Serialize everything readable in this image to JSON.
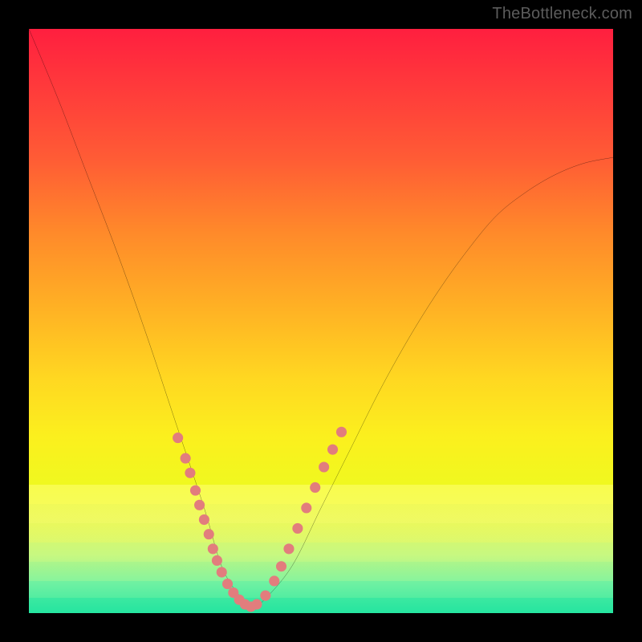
{
  "watermark": "TheBottleneck.com",
  "colors": {
    "curve": "#000000",
    "dots": "#e27d7d",
    "background_frame": "#000000"
  },
  "chart_data": {
    "type": "line",
    "title": "",
    "xlabel": "",
    "ylabel": "",
    "xlim": [
      0,
      100
    ],
    "ylim": [
      0,
      100
    ],
    "series": [
      {
        "name": "bottleneck-curve",
        "x": [
          0,
          5,
          10,
          15,
          20,
          25,
          30,
          33,
          36,
          38,
          40,
          45,
          50,
          55,
          60,
          65,
          70,
          75,
          80,
          85,
          90,
          95,
          100
        ],
        "y": [
          100,
          88,
          75,
          62,
          48,
          33,
          18,
          8,
          3,
          1,
          2,
          8,
          18,
          28,
          38,
          47,
          55,
          62,
          68,
          72,
          75,
          77,
          78
        ]
      }
    ],
    "highlight_points": {
      "name": "highlighted-range-dots",
      "x": [
        25.5,
        26.8,
        27.6,
        28.5,
        29.2,
        30.0,
        30.8,
        31.5,
        32.2,
        33.0,
        34.0,
        35.0,
        36.0,
        37.0,
        38.0,
        39.0,
        40.5,
        42.0,
        43.2,
        44.5,
        46.0,
        47.5,
        49.0,
        50.5,
        52.0,
        53.5
      ],
      "y": [
        30.0,
        26.5,
        24.0,
        21.0,
        18.5,
        16.0,
        13.5,
        11.0,
        9.0,
        7.0,
        5.0,
        3.5,
        2.3,
        1.5,
        1.1,
        1.5,
        3.0,
        5.5,
        8.0,
        11.0,
        14.5,
        18.0,
        21.5,
        25.0,
        28.0,
        31.0
      ]
    }
  }
}
